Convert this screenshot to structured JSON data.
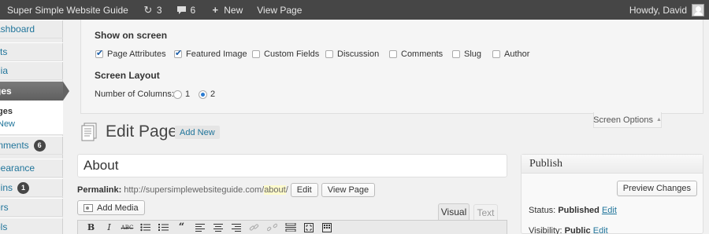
{
  "adminbar": {
    "site_name": "Super Simple Website Guide",
    "updates_count": "3",
    "comments_count": "6",
    "new_label": "New",
    "view_page_label": "View Page",
    "howdy": "Howdy, David"
  },
  "menu": {
    "items": [
      {
        "label": "Dashboard",
        "shown": "ashboard"
      },
      {
        "label": "Posts",
        "shown": "sts"
      },
      {
        "label": "Media",
        "shown": "dia"
      },
      {
        "label": "Pages",
        "shown": "ges"
      },
      {
        "label": "Comments",
        "shown": "mments",
        "badge": "6"
      },
      {
        "label": "Appearance",
        "shown": "pearance"
      },
      {
        "label": "Plugins",
        "shown": "gins",
        "badge": "1"
      },
      {
        "label": "Users",
        "shown": "ers"
      },
      {
        "label": "Tools",
        "shown": "ols"
      }
    ],
    "submenu": {
      "all_pages": "ges",
      "add_new": "New"
    }
  },
  "screen_options": {
    "show_on_screen_heading": "Show on screen",
    "checkboxes": [
      {
        "label": "Page Attributes",
        "checked": true
      },
      {
        "label": "Featured Image",
        "checked": true
      },
      {
        "label": "Custom Fields",
        "checked": false
      },
      {
        "label": "Discussion",
        "checked": false
      },
      {
        "label": "Comments",
        "checked": false
      },
      {
        "label": "Slug",
        "checked": false
      },
      {
        "label": "Author",
        "checked": false
      }
    ],
    "layout_heading": "Screen Layout",
    "columns_label": "Number of Columns:",
    "column_options": [
      {
        "label": "1",
        "checked": false
      },
      {
        "label": "2",
        "checked": true
      }
    ],
    "tab_label": "Screen Options"
  },
  "editor": {
    "page_title": "Edit Page",
    "add_new_label": "Add New",
    "title_value": "About",
    "permalink_label": "Permalink:",
    "permalink_base": "http://supersimplewebsiteguide.com/",
    "permalink_slug": "about",
    "permalink_end": "/",
    "edit_label": "Edit",
    "view_page_label": "View Page",
    "add_media_label": "Add Media",
    "tab_visual": "Visual",
    "tab_text": "Text",
    "toolbar_icons": [
      "bold-icon",
      "italic-icon",
      "strikethrough-icon",
      "bulleted-list-icon",
      "numbered-list-icon",
      "blockquote-icon",
      "align-left-icon",
      "align-center-icon",
      "align-right-icon",
      "insert-link-icon",
      "unlink-icon",
      "read-more-icon",
      "fullscreen-icon",
      "toolbar-toggle-icon"
    ]
  },
  "publish": {
    "heading": "Publish",
    "preview_label": "Preview Changes",
    "status_label": "Status:",
    "status_value": "Published",
    "status_edit": "Edit",
    "visibility_label": "Visibility:",
    "visibility_value": "Public",
    "visibility_edit": "Edit"
  }
}
